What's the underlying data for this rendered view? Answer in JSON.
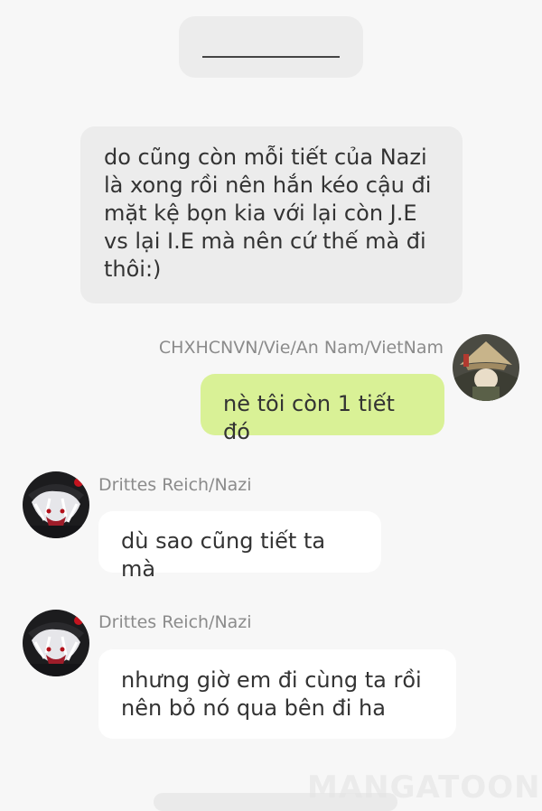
{
  "narration_bubble": {
    "text": "do cũng còn mỗi tiết của Nazi\nlà xong rồi nên hắn kéo cậu đi\nmặt kệ bọn kia với lại còn J.E\nvs lại I.E mà nên cứ thế mà đi\nthôi:)"
  },
  "messages": [
    {
      "sender": "CHXHCNVN/Vie/An Nam/VietNam",
      "text": "nè tôi còn 1 tiết đó",
      "side": "right",
      "bubble_color": "#d9f196"
    },
    {
      "sender": "Drittes Reich/Nazi",
      "text": "dù sao cũng tiết ta mà",
      "side": "left",
      "bubble_color": "#ffffff"
    },
    {
      "sender": "Drittes Reich/Nazi",
      "text": "nhưng giờ em đi cùng ta rồi\nnên bỏ nó qua bên đi ha",
      "side": "left",
      "bubble_color": "#ffffff"
    }
  ],
  "watermark": {
    "text": "MANGATOON"
  },
  "colors": {
    "background": "#f7f7f7",
    "narration_bubble": "#ececec",
    "name_text": "#8b8b8b"
  }
}
